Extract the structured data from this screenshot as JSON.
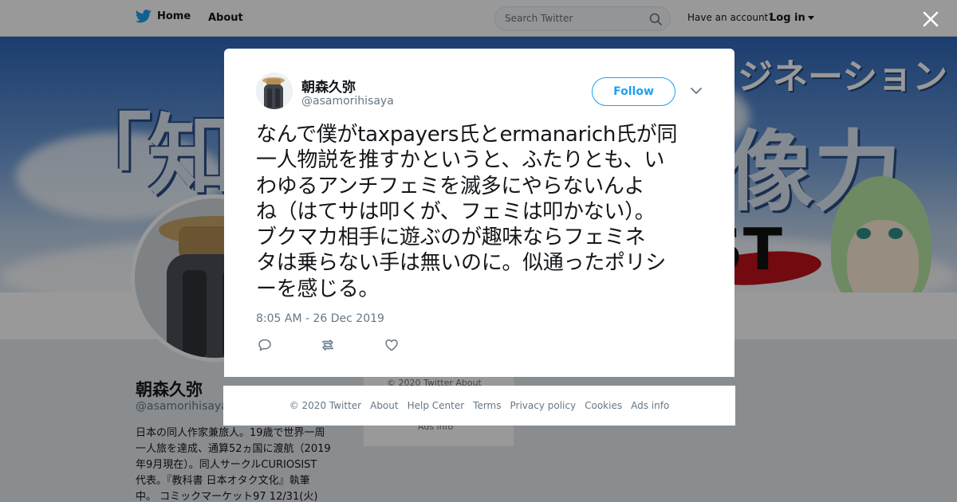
{
  "nav": {
    "home": "Home",
    "about": "About",
    "search_placeholder": "Search Twitter",
    "have_account": "Have an account?",
    "login": "Log in"
  },
  "banner": {
    "left_text": "「知る",
    "right_text": "像力",
    "top_text": "ジネーション",
    "bottom_text": "ST"
  },
  "profile": {
    "name": "朝森久弥",
    "handle": "@asamorihisaya",
    "bio": "日本の同人作家兼旅人。19歳で世界一周\n一人旅を達成、通算52ヵ国に渡航（2019\n年9月現在）。同人サークルCURIOSIST\n代表。『教科書 日本オタク文化』執筆\n中。 コミックマーケット97 12/31(火)",
    "side_copyright": "© 2020 Twitter   About",
    "side_ads": "Ads info"
  },
  "tweet": {
    "name": "朝森久弥",
    "handle": "@asamorihisaya",
    "follow_label": "Follow",
    "text": "なんで僕がtaxpayers氏とermanarich氏が同\n一人物説を推すかというと、ふたりとも、い\nわゆるアンチフェミを滅多にやらないんよ\nね（はてサは叩くが、フェミは叩かない）。\nブクマカ相手に遊ぶのが趣味ならフェミネ\nタは乗らない手は無いのに。似通ったポリシ\nーを感じる。",
    "timestamp": "8:05 AM - 26 Dec 2019"
  },
  "footer": {
    "links": [
      "© 2020 Twitter",
      "About",
      "Help Center",
      "Terms",
      "Privacy policy",
      "Cookies",
      "Ads info"
    ]
  },
  "colors": {
    "accent": "#1da1f2",
    "muted": "#657786",
    "text": "#14171a"
  },
  "icons": [
    "twitter-bird-icon",
    "search-icon",
    "close-icon",
    "chevron-down-icon",
    "reply-icon",
    "retweet-icon",
    "like-icon"
  ]
}
